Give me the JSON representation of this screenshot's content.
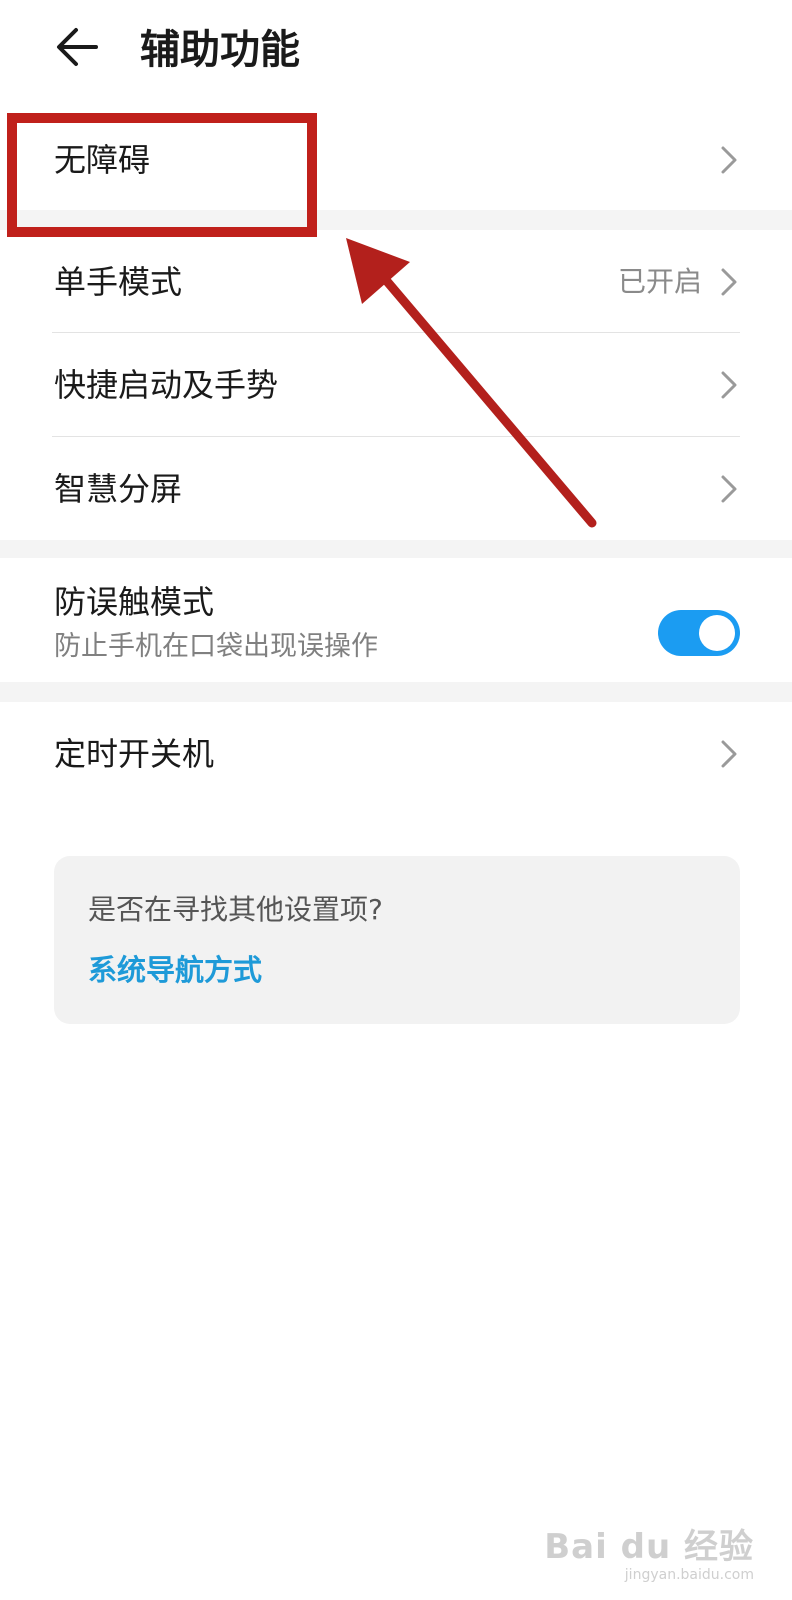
{
  "header": {
    "title": "辅助功能",
    "back_icon": "arrow-left-icon"
  },
  "items": {
    "accessibility": {
      "label": "无障碍"
    },
    "one_hand": {
      "label": "单手模式",
      "value": "已开启"
    },
    "shortcut": {
      "label": "快捷启动及手势"
    },
    "split_screen": {
      "label": "智慧分屏"
    },
    "pocket_mode": {
      "label": "防误触模式",
      "sublabel": "防止手机在口袋出现误操作",
      "toggle_on": true
    },
    "scheduled_power": {
      "label": "定时开关机"
    }
  },
  "suggestion_card": {
    "question": "是否在寻找其他设置项?",
    "link": "系统导航方式"
  },
  "annotation": {
    "box_color": "#c0201b",
    "arrow_color": "#b3201c"
  },
  "watermark": {
    "brand": "Bai du 经验",
    "url": "jingyan.baidu.com"
  },
  "colors": {
    "accent": "#1b9cf2",
    "link": "#1e9ad8"
  }
}
